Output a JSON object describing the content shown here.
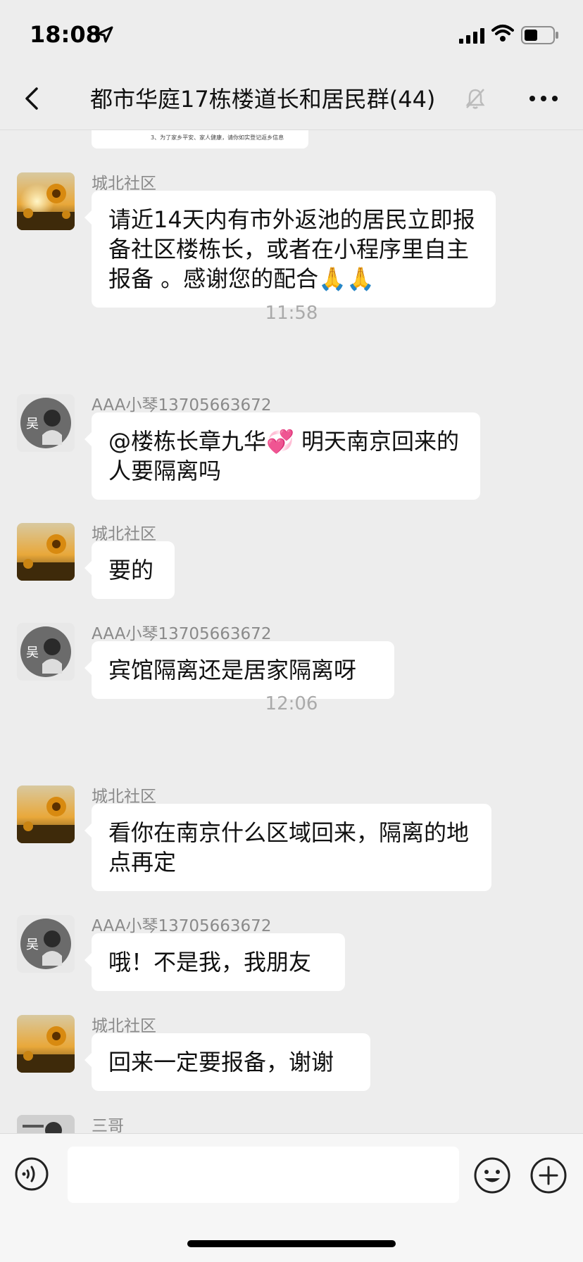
{
  "status": {
    "time": "18:08"
  },
  "nav": {
    "title": "都市华庭17栋楼道长和居民群(44)"
  },
  "partial_card_text": "3、为了家乡平安、家人健康，请你如实登记返乡信息",
  "messages": [
    {
      "sender": "城北社区",
      "text": "请近14天内有市外返池的居民立即报备社区楼栋长，或者在小程序里自主报备 。感谢您的配合🙏🙏"
    },
    {
      "timestamp": "11:58"
    },
    {
      "sender": "AAA小琴13705663672",
      "text": "@楼栋长章九华💞 明天南京回来的人要隔离吗"
    },
    {
      "sender": "城北社区",
      "text": "要的"
    },
    {
      "sender": "AAA小琴13705663672",
      "text": "宾馆隔离还是居家隔离呀"
    },
    {
      "timestamp": "12:06"
    },
    {
      "sender": "城北社区",
      "text": "看你在南京什么区域回来，隔离的地点再定"
    },
    {
      "sender": "AAA小琴13705663672",
      "text": "哦！不是我，我朋友"
    },
    {
      "sender": "城北社区",
      "text": "回来一定要报备，谢谢"
    },
    {
      "sender": "三哥",
      "text": ""
    }
  ],
  "colors": {
    "background": "#ededed",
    "bubble": "#ffffff",
    "sender": "#8a8a8a",
    "timestamp": "#aaaaaa"
  }
}
